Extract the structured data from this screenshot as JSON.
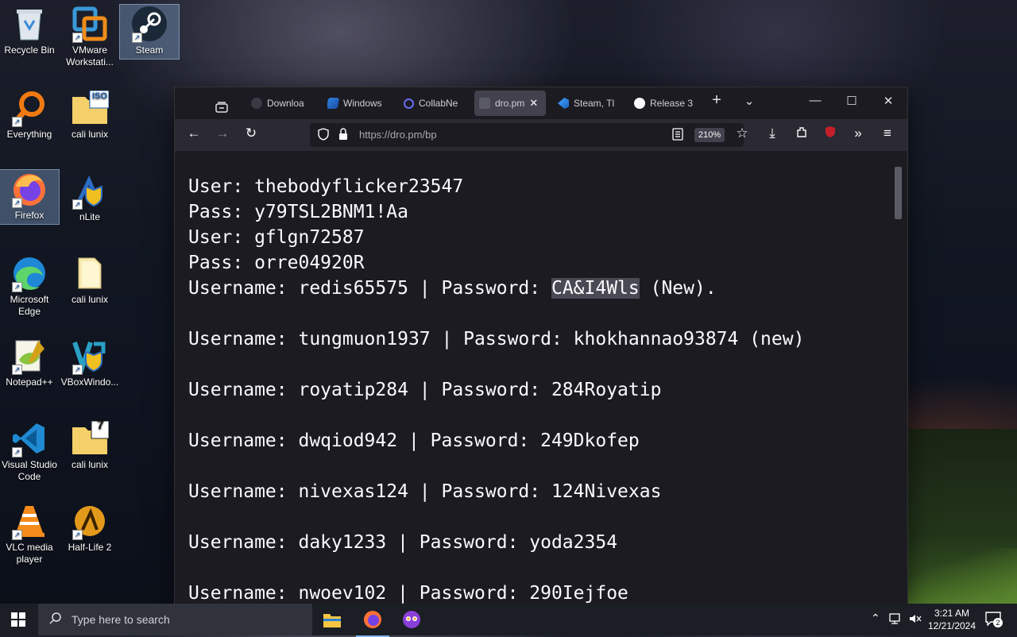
{
  "desktop": {
    "icons": [
      {
        "label": "Recycle Bin"
      },
      {
        "label": "VMware Workstati..."
      },
      {
        "label": "Steam"
      },
      {
        "label": "Everything"
      },
      {
        "label": "cali lunix"
      },
      {
        "label": "Firefox"
      },
      {
        "label": "nLite"
      },
      {
        "label": "Microsoft Edge"
      },
      {
        "label": "cali lunix"
      },
      {
        "label": "Notepad++"
      },
      {
        "label": "VBoxWindo..."
      },
      {
        "label": "Visual Studio Code"
      },
      {
        "label": "cali lunix"
      },
      {
        "label": "VLC media player"
      },
      {
        "label": "Half-Life 2"
      }
    ],
    "iso_badge": "ISO",
    "seven_badge": "7"
  },
  "browser": {
    "tabs": [
      {
        "label": "Downloa",
        "icon": "download-icon"
      },
      {
        "label": "Windows",
        "icon": "windows-icon"
      },
      {
        "label": "CollabNe",
        "icon": "search-icon"
      },
      {
        "label": "dro.pm",
        "icon": "page-icon",
        "active": true
      },
      {
        "label": "Steam, Tl",
        "icon": "vscode-icon"
      },
      {
        "label": "Release 3",
        "icon": "github-icon"
      }
    ],
    "url": "https://dro.pm/bp",
    "zoom": "210%",
    "content_lines": [
      {
        "text": "User: thebodyflicker23547"
      },
      {
        "text": "Pass: y79TSL2BNM1!Aa"
      },
      {
        "text": "User: gflgn72587"
      },
      {
        "text": "Pass: orre04920R"
      },
      {
        "prefix": "Username: redis65575 | Password: ",
        "highlight": "CA&I4Wls",
        "suffix": " (New)."
      },
      {
        "text": "Username: tungmuon1937 | Password: khokhannao93874 (new)"
      },
      {
        "text": "Username: royatip284 | Password: 284Royatip"
      },
      {
        "text": "Username: dwqiod942 | Password: 249Dkofep"
      },
      {
        "text": "Username: nivexas124 | Password: 124Nivexas"
      },
      {
        "text": "Username: daky1233 | Password: yoda2354"
      },
      {
        "text": "Username: nwoev102 | Password: 290Iejfoe"
      }
    ]
  },
  "taskbar": {
    "search_placeholder": "Type here to search",
    "time": "3:21 AM",
    "date": "12/21/2024",
    "notifications": "2"
  },
  "colors": {
    "browser_bg": "#1c1b22",
    "toolbar_bg": "#2b2a33",
    "text": "#fbfbfe",
    "taskbar_bg": "#1b1e24"
  }
}
